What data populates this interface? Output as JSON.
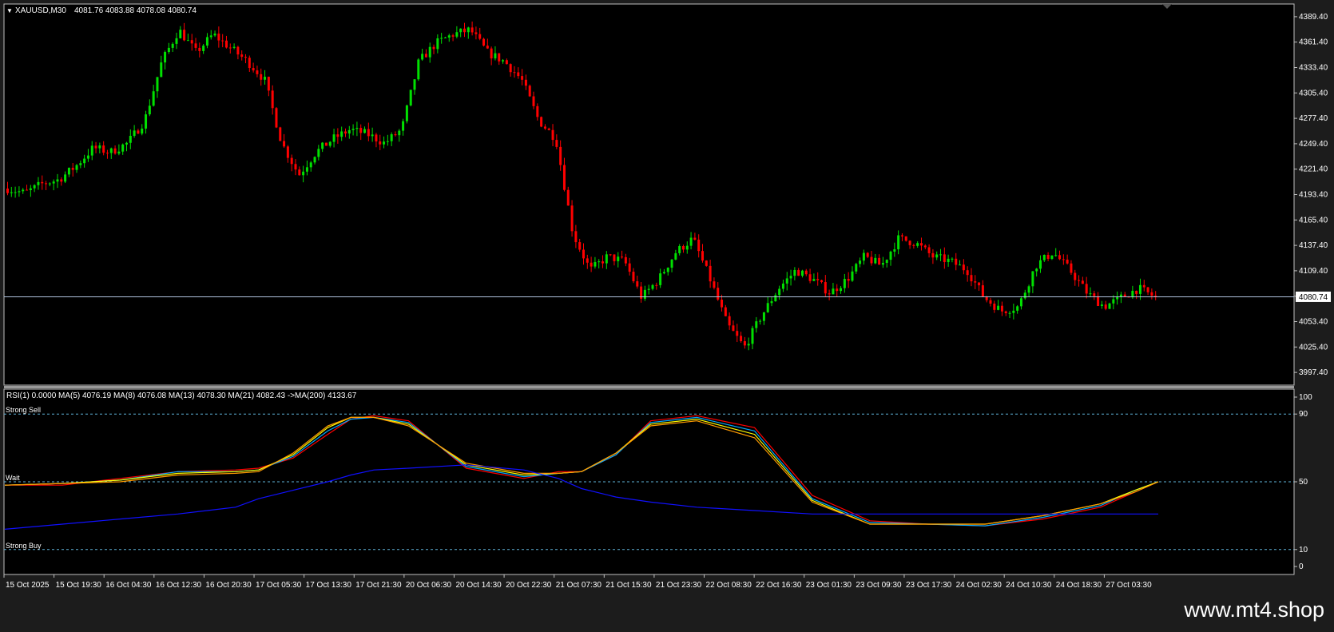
{
  "watermark": "www.mt4.shop",
  "main_chart": {
    "header_symbol": "XAUUSD,M30",
    "header_ohlc": "4081.76 4083.88 4078.08 4080.74",
    "current_price_label": "4080.74"
  },
  "indicator": {
    "header": "RSI(1) 0.0000  MA(5) 4076.19  MA(8) 4076.08  MA(13) 4078.30  MA(21) 4082.43  ->MA(200) 4133.67",
    "levels": [
      {
        "value": 90,
        "label": "Strong Sell"
      },
      {
        "value": 50,
        "label": "Wait"
      },
      {
        "value": 10,
        "label": "Strong Buy"
      }
    ],
    "scale_labels": [
      "100",
      "90",
      "50",
      "10",
      "0"
    ]
  },
  "colors": {
    "background": "#000000",
    "frame": "#c0c0c0",
    "bull": "#00e000",
    "bear": "#ff0000",
    "ma5": "#ff0000",
    "ma8": "#00aaff",
    "ma13": "#ffff00",
    "ma21": "#ff9900",
    "ma200": "#1010ff",
    "level_line": "#5fb3d9",
    "price_line": "#b0c4de"
  },
  "chart_data": [
    {
      "type": "candlestick",
      "title": "XAUUSD,M30",
      "ylim": [
        3983.4,
        4403.4
      ],
      "y_ticks": [
        3997.4,
        4025.4,
        4053.4,
        4081.4,
        4109.4,
        4137.4,
        4165.4,
        4193.4,
        4221.4,
        4249.4,
        4277.4,
        4305.4,
        4333.4,
        4361.4,
        4389.4
      ],
      "y_tick_labels": [
        "3997.40",
        "4025.40",
        "4053.40",
        "4081.40",
        "4109.40",
        "4137.40",
        "4165.40",
        "4193.40",
        "4221.40",
        "4249.40",
        "4277.40",
        "4305.40",
        "4333.40",
        "4361.40",
        "4389.40"
      ],
      "x_tick_labels": [
        "15 Oct 2025",
        "15 Oct 19:30",
        "16 Oct 04:30",
        "16 Oct 12:30",
        "16 Oct 20:30",
        "17 Oct 05:30",
        "17 Oct 13:30",
        "17 Oct 21:30",
        "20 Oct 06:30",
        "20 Oct 14:30",
        "20 Oct 22:30",
        "21 Oct 07:30",
        "21 Oct 15:30",
        "21 Oct 23:30",
        "22 Oct 08:30",
        "22 Oct 16:30",
        "23 Oct 01:30",
        "23 Oct 09:30",
        "23 Oct 17:30",
        "24 Oct 02:30",
        "24 Oct 10:30",
        "24 Oct 18:30",
        "27 Oct 03:30"
      ],
      "close_path": [
        4200,
        4195,
        4205,
        4210,
        4225,
        4245,
        4240,
        4250,
        4275,
        4340,
        4375,
        4350,
        4370,
        4355,
        4340,
        4320,
        4250,
        4215,
        4240,
        4255,
        4265,
        4260,
        4250,
        4265,
        4340,
        4360,
        4370,
        4375,
        4350,
        4340,
        4320,
        4275,
        4255,
        4150,
        4110,
        4125,
        4120,
        4080,
        4100,
        4130,
        4145,
        4100,
        4050,
        4025,
        4060,
        4090,
        4110,
        4100,
        4085,
        4100,
        4125,
        4115,
        4145,
        4140,
        4125,
        4120,
        4110,
        4080,
        4065,
        4070,
        4115,
        4130,
        4110,
        4085,
        4070,
        4080,
        4090,
        4080
      ],
      "current_price": 4080.74
    },
    {
      "type": "line",
      "title": "RSI(1) 0.0000",
      "ylim": [
        0,
        100
      ],
      "levels": [
        90,
        50,
        10
      ],
      "series": [
        {
          "name": "MA(5)",
          "x": [
            0,
            5,
            10,
            15,
            20,
            22,
            25,
            28,
            30,
            32,
            35,
            40,
            45,
            48,
            50,
            53,
            56,
            60,
            65,
            70,
            75,
            80,
            85,
            90,
            95,
            98,
            100
          ],
          "values": [
            48,
            48,
            52,
            56,
            57,
            58,
            64,
            78,
            87,
            89,
            86,
            58,
            52,
            56,
            56,
            66,
            86,
            89,
            82,
            42,
            27,
            25,
            24,
            28,
            35,
            44,
            50
          ]
        },
        {
          "name": "MA(8)",
          "x": [
            0,
            5,
            10,
            15,
            20,
            22,
            25,
            28,
            30,
            32,
            35,
            40,
            45,
            48,
            50,
            53,
            56,
            60,
            65,
            70,
            75,
            80,
            85,
            90,
            95,
            98,
            100
          ],
          "values": [
            48,
            49,
            51,
            56,
            56,
            57,
            65,
            80,
            87,
            88,
            85,
            59,
            53,
            55,
            56,
            66,
            85,
            88,
            80,
            40,
            26,
            25,
            24,
            29,
            36,
            45,
            50
          ]
        },
        {
          "name": "MA(13)",
          "x": [
            0,
            5,
            10,
            15,
            20,
            22,
            25,
            28,
            30,
            32,
            35,
            40,
            45,
            48,
            50,
            53,
            56,
            60,
            65,
            70,
            75,
            80,
            85,
            90,
            95,
            98,
            100
          ],
          "values": [
            48,
            49,
            51,
            55,
            56,
            57,
            66,
            82,
            88,
            88,
            84,
            60,
            54,
            55,
            56,
            67,
            84,
            87,
            78,
            39,
            25,
            25,
            25,
            30,
            37,
            45,
            50
          ]
        },
        {
          "name": "MA(21)",
          "x": [
            0,
            5,
            10,
            15,
            20,
            22,
            25,
            28,
            30,
            32,
            35,
            40,
            45,
            48,
            50,
            53,
            56,
            60,
            65,
            70,
            75,
            80,
            85,
            90,
            95,
            98,
            100
          ],
          "values": [
            48,
            49,
            50,
            54,
            55,
            56,
            67,
            83,
            88,
            88,
            83,
            61,
            55,
            55,
            56,
            67,
            83,
            86,
            76,
            38,
            25,
            25,
            25,
            30,
            37,
            44,
            50
          ]
        },
        {
          "name": "MA(200)",
          "x": [
            0,
            5,
            10,
            15,
            20,
            22,
            25,
            28,
            30,
            32,
            35,
            40,
            45,
            48,
            50,
            53,
            56,
            60,
            65,
            70,
            75,
            80,
            85,
            90,
            95,
            98,
            100
          ],
          "values": [
            22,
            25,
            28,
            31,
            35,
            40,
            45,
            50,
            54,
            57,
            58,
            60,
            57,
            52,
            46,
            41,
            38,
            35,
            33,
            31,
            31,
            31,
            31,
            31,
            31,
            31,
            31
          ]
        }
      ]
    }
  ]
}
